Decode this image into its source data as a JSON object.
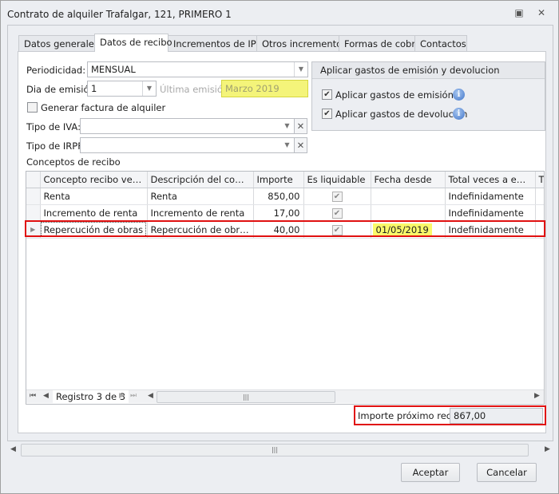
{
  "window": {
    "title": "Contrato de alquiler Trafalgar, 121, PRIMERO 1"
  },
  "tabs": [
    "Datos generales",
    "Datos de recibo",
    "Incrementos de IPC",
    "Otros incrementos",
    "Formas de cobro",
    "Contactos"
  ],
  "active_tab": "Datos de recibo",
  "form": {
    "periodicidad_label": "Periodicidad:",
    "periodicidad_value": "MENSUAL",
    "dia_label": "Dia de emisión:",
    "dia_value": "1",
    "ultima_label": "Última emisión:",
    "ultima_value": "Marzo 2019",
    "generar_label": "Generar factura de alquiler",
    "generar_checked": false,
    "iva_label": "Tipo de IVA:",
    "iva_value": "",
    "irpf_label": "Tipo de IRPF:",
    "irpf_value": ""
  },
  "gastos": {
    "title": "Aplicar gastos de emisión y devolucion",
    "emision_label": "Aplicar gastos de emisión",
    "emision_checked": true,
    "devolucion_label": "Aplicar gastos de devolución",
    "devolucion_checked": true
  },
  "conceptos": {
    "label": "Conceptos de recibo",
    "columns": [
      "Concepto recibo vert…",
      "Descripción del concepto",
      "Importe",
      "Es liquidable",
      "Fecha desde",
      "Total veces a emitir",
      "T"
    ],
    "rows": [
      {
        "concepto": "Renta",
        "descripcion": "Renta",
        "importe": "850,00",
        "liquidable": true,
        "fecha": "",
        "total": "Indefinidamente"
      },
      {
        "concepto": "Incremento de renta",
        "descripcion": "Incremento de renta",
        "importe": "17,00",
        "liquidable": true,
        "fecha": "",
        "total": "Indefinidamente"
      },
      {
        "concepto": "Repercución de obras",
        "descripcion": "Repercución de obras",
        "importe": "40,00",
        "liquidable": true,
        "fecha": "01/05/2019",
        "total": "Indefinidamente"
      }
    ],
    "navigator": "Registro 3 de 3"
  },
  "importe": {
    "label": "Importe próximo recibo",
    "value": "867,00"
  },
  "buttons": {
    "aceptar": "Aceptar",
    "cancelar": "Cancelar"
  }
}
